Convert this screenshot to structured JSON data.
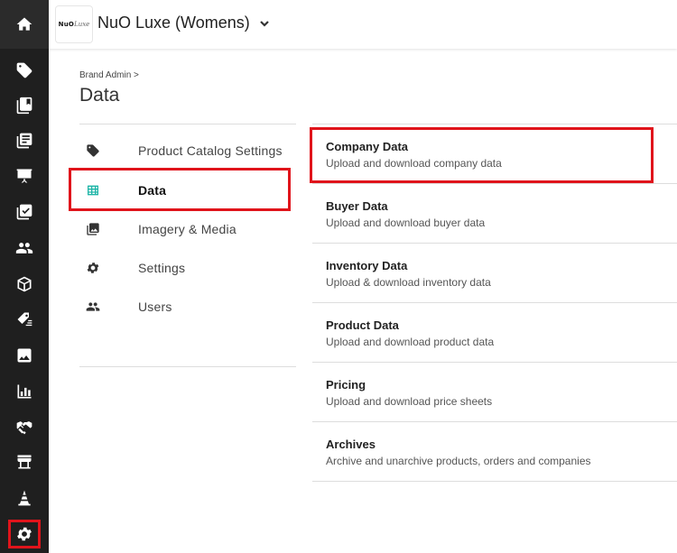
{
  "header": {
    "logo_text": "NuO",
    "logo_script": "Luxe",
    "brand_name": "NuO Luxe (Womens)"
  },
  "page": {
    "breadcrumb": "Brand Admin >",
    "title": "Data"
  },
  "settings_nav": [
    {
      "label": "Product Catalog Settings",
      "icon": "tag-icon"
    },
    {
      "label": "Data",
      "icon": "table-icon",
      "active": true
    },
    {
      "label": "Imagery & Media",
      "icon": "images-icon"
    },
    {
      "label": "Settings",
      "icon": "gear-icon"
    },
    {
      "label": "Users",
      "icon": "users-icon"
    }
  ],
  "data_items": [
    {
      "title": "Company Data",
      "subtitle": "Upload and download company data"
    },
    {
      "title": "Buyer Data",
      "subtitle": "Upload and download buyer data"
    },
    {
      "title": "Inventory Data",
      "subtitle": "Upload & download inventory data"
    },
    {
      "title": "Product Data",
      "subtitle": "Upload and download product data"
    },
    {
      "title": "Pricing",
      "subtitle": "Upload and download price sheets"
    },
    {
      "title": "Archives",
      "subtitle": "Archive and unarchive products, orders and companies"
    }
  ],
  "colors": {
    "rail_bg": "#1f1f1f",
    "highlight": "#e0141b",
    "table_icon": "#1fb5a7"
  }
}
